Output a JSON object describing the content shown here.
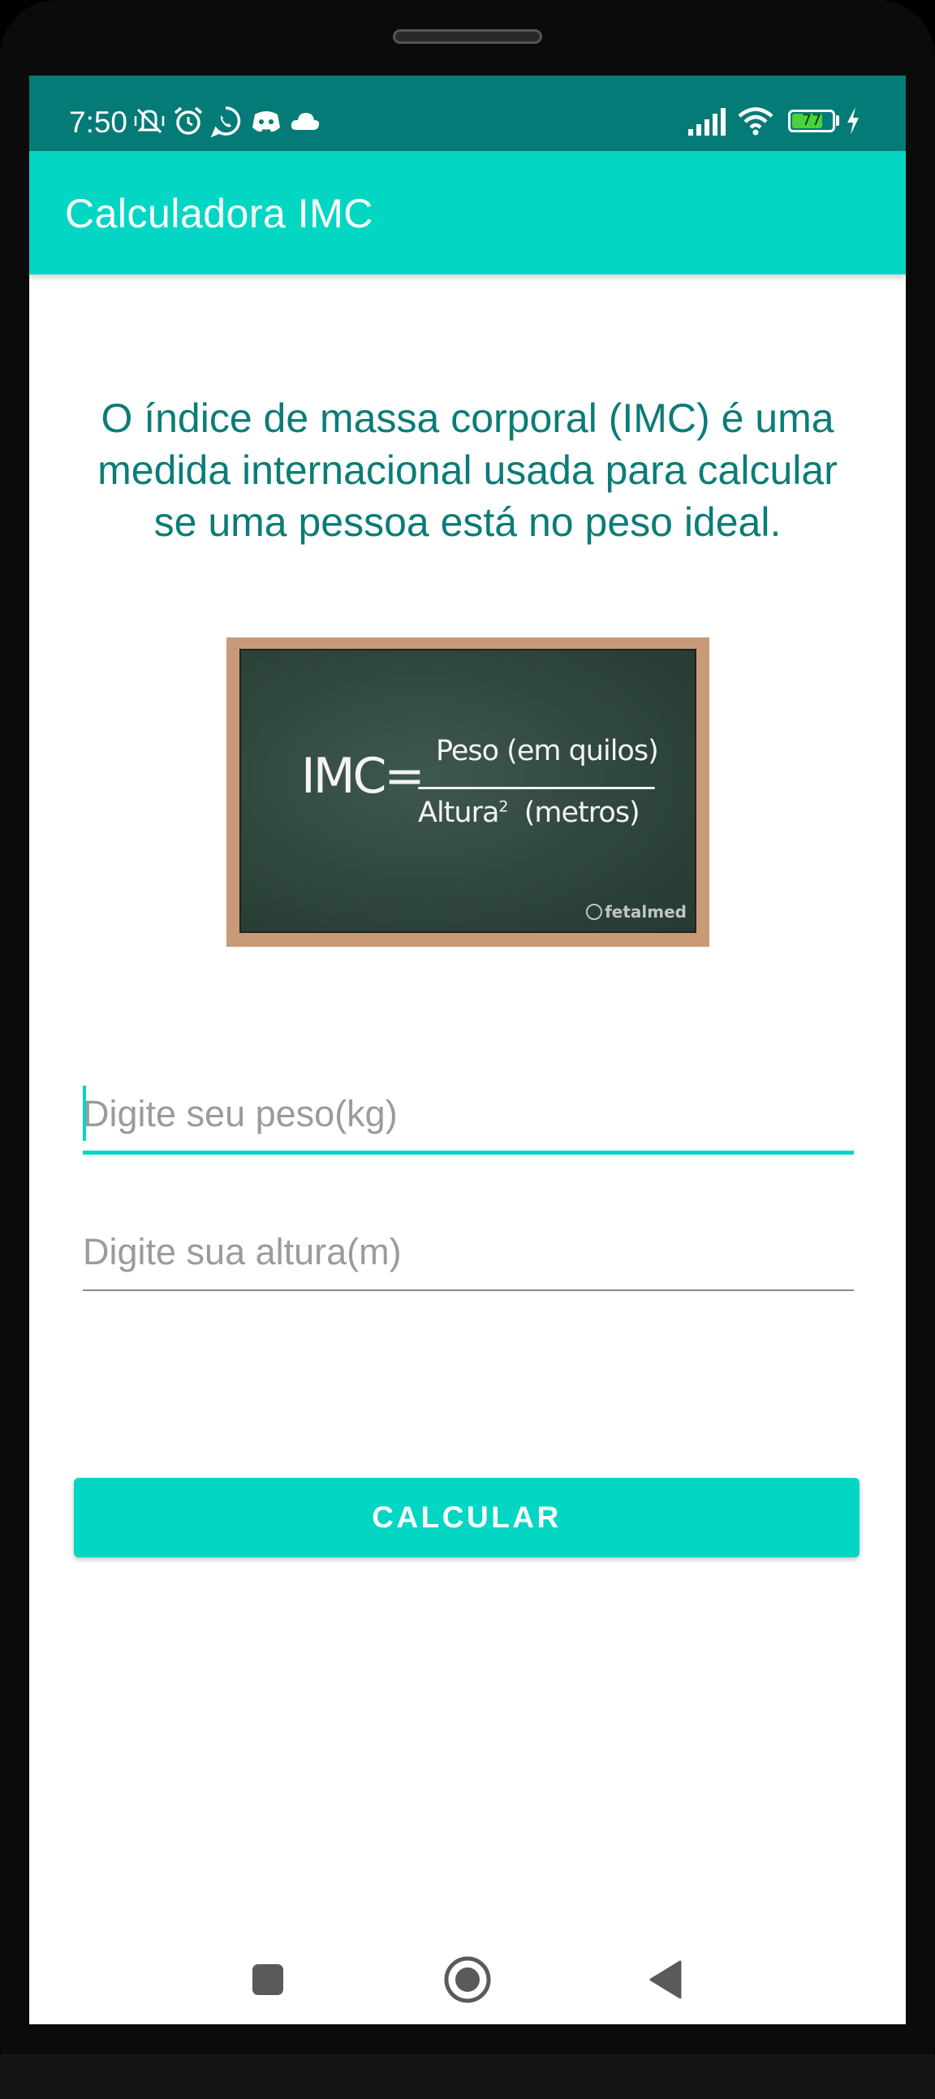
{
  "status_bar": {
    "time": "7:50",
    "battery_level": "77",
    "icons": [
      "mute-vibrate-icon",
      "alarm-icon",
      "whatsapp-icon",
      "discord-icon",
      "cloud-icon",
      "signal-icon",
      "wifi-icon",
      "battery-icon",
      "charging-icon"
    ]
  },
  "app_bar": {
    "title": "Calculadora IMC"
  },
  "main": {
    "description": "O índice de massa corporal (IMC) é uma medida internacional usada para calcular se uma pessoa está no peso ideal.",
    "image": {
      "formula_lhs": "IMC=",
      "numerator": "Peso (em quilos)",
      "denominator_word": "Altura",
      "denominator_exponent": "2",
      "denominator_unit": "(metros)",
      "watermark": "fetalmed"
    },
    "weight_input": {
      "value": "",
      "placeholder": "Digite seu peso(kg)"
    },
    "height_input": {
      "value": "",
      "placeholder": "Digite sua altura(m)"
    },
    "calculate_button": "CALCULAR"
  },
  "nav_bar": {
    "buttons": [
      "recents-square-icon",
      "home-circle-icon",
      "back-triangle-icon"
    ]
  },
  "colors": {
    "accent": "#03d7c4",
    "status_bar": "#047b76",
    "text_teal": "#0b7c78",
    "hint_gray": "#9b9b9b"
  }
}
